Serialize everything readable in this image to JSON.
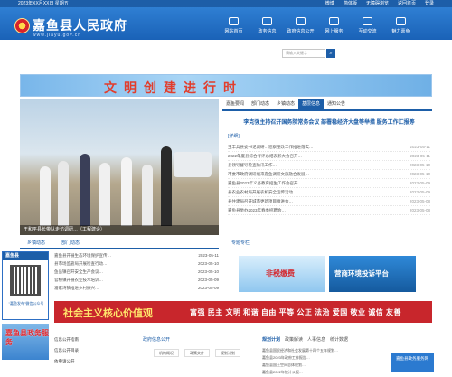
{
  "topbar": {
    "left": "2023年XX月XX日 星期五",
    "links": [
      "微博",
      "简体版",
      "无障碍浏览",
      "返回首页",
      "登录"
    ]
  },
  "header": {
    "title": "嘉鱼县人民政府",
    "url": "www.jiayu.gov.cn",
    "nav": [
      "网站首页",
      "政务信息",
      "政府信息公开",
      "网上服务",
      "互动交流",
      "魅力嘉鱼"
    ]
  },
  "search": {
    "placeholder": "请输入关键字"
  },
  "banner": {
    "text": "文明创建进行时"
  },
  "photo": {
    "caption": "王和平县长带队走访调研…（工程建设）"
  },
  "news": {
    "tabs": [
      "嘉鱼要闻",
      "部门动态",
      "乡镇动态",
      "基层信息",
      "通知公告"
    ],
    "headline": "李克强主持召开国务院常务会议 部署稳经济大盘等举措 服务工作汇报等",
    "detail": "[详细]",
    "items": [
      {
        "text": "王丰兵县委书记调研…巡察整改工作推进落实…",
        "date": "2023-05-11"
      },
      {
        "text": "2022年度县综合考评总结表彰大会召开…",
        "date": "2023-05-11"
      },
      {
        "text": "县领导督导检查防汛工作…",
        "date": "2023-05-10"
      },
      {
        "text": "市委市政府调研组来嘉鱼调研文旅融合发展…",
        "date": "2023-05-10"
      },
      {
        "text": "嘉鱼县2023年义务教育招生工作会召开…",
        "date": "2023-05-09"
      },
      {
        "text": "县农业农村局开展农机安全宣传活动…",
        "date": "2023-05-09"
      },
      {
        "text": "县住建局召开城市更新项目推进会…",
        "date": "2023-05-08"
      },
      {
        "text": "嘉鱼县举办2023年春季招聘会…",
        "date": "2023-05-08"
      }
    ]
  },
  "left_panel": {
    "tabs": [
      "乡镇动态",
      "部门动态"
    ],
    "items": [
      {
        "text": "嘉鱼县开展生态环境保护宣传…",
        "date": "2023-05-11"
      },
      {
        "text": "县市场监管局开展检查行动…",
        "date": "2023-05-10"
      },
      {
        "text": "鱼岳镇召开安全生产会议…",
        "date": "2023-05-10"
      },
      {
        "text": "官桥镇开展农业技术培训…",
        "date": "2023-05-09"
      },
      {
        "text": "潘家湾镇推进乡村振兴…",
        "date": "2023-05-09"
      }
    ]
  },
  "special": {
    "title": "专题专栏",
    "item1": "非税缴费",
    "item2": "营商环境投诉平台"
  },
  "values_bar": {
    "title": "社会主义核心价值观",
    "text": "富强 民主 文明 和谐 自由 平等 公正 法治 爱国 敬业 诚信 友善"
  },
  "float_ad": {
    "title": "嘉鱼县",
    "caption": "“嘉鱼发布”微信公众号",
    "bottom": "嘉鱼县政务服务"
  },
  "sub_left": [
    "信息公开指南",
    "信息公开目录",
    "依申请公开"
  ],
  "public": {
    "title": "政府信息公开",
    "items": [
      "机构概况",
      "政策文件",
      "规划计划",
      "财政信息",
      "人事信息",
      "统计信息"
    ]
  },
  "plan": {
    "tabs": [
      "规划计划",
      "政策解读",
      "人事信息",
      "统计数据"
    ],
    "items": [
      "嘉鱼县国民经济和社会发展第十四个五年规划…",
      "嘉鱼县2023年政府工作报告…",
      "嘉鱼县国土空间总体规划…",
      "嘉鱼县2022年统计公报…"
    ]
  },
  "corner": {
    "text": "嘉鱼县政务服务网"
  }
}
